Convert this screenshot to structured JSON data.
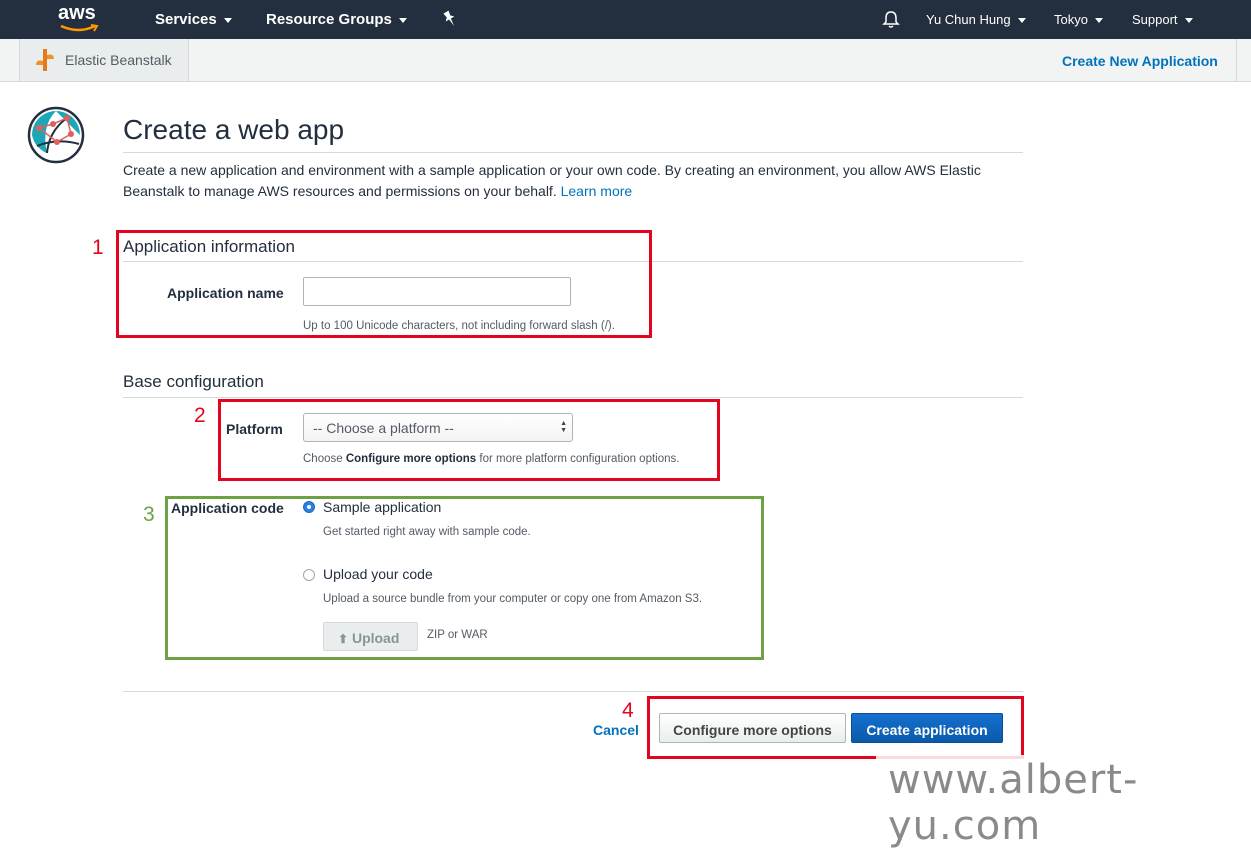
{
  "topbar": {
    "logo_text": "aws",
    "services": "Services",
    "resource_groups": "Resource Groups",
    "user": "Yu Chun Hung",
    "region": "Tokyo",
    "support": "Support"
  },
  "subbar": {
    "service_name": "Elastic Beanstalk",
    "create_new_app": "Create New Application"
  },
  "page": {
    "title": "Create a web app",
    "description": "Create a new application and environment with a sample application or your own code. By creating an environment, you allow AWS Elastic Beanstalk to manage AWS resources and permissions on your behalf.",
    "learn_more": "Learn more"
  },
  "app_info": {
    "heading": "Application information",
    "name_label": "Application name",
    "name_value": "",
    "name_help": "Up to 100 Unicode characters, not including forward slash (/)."
  },
  "base_config": {
    "heading": "Base configuration",
    "platform_label": "Platform",
    "platform_selected": "-- Choose a platform --",
    "platform_help_pre": "Choose ",
    "platform_help_bold": "Configure more options",
    "platform_help_post": " for more platform configuration options.",
    "code_label": "Application code",
    "sample_label": "Sample application",
    "sample_help": "Get started right away with sample code.",
    "upload_label": "Upload your code",
    "upload_help": "Upload a source bundle from your computer or copy one from Amazon S3.",
    "upload_button": "Upload",
    "upload_formats": "ZIP or WAR"
  },
  "actions": {
    "cancel": "Cancel",
    "configure": "Configure more options",
    "create": "Create application"
  },
  "annotations": {
    "n1": "1",
    "n2": "2",
    "n3": "3",
    "n4": "4",
    "red": "#e3051e",
    "green": "#6ea143"
  },
  "watermark": "www.albert-yu.com",
  "colors": {
    "topbar": "#232f3e",
    "link": "#0073bb",
    "primary": "#0a5aa8"
  }
}
